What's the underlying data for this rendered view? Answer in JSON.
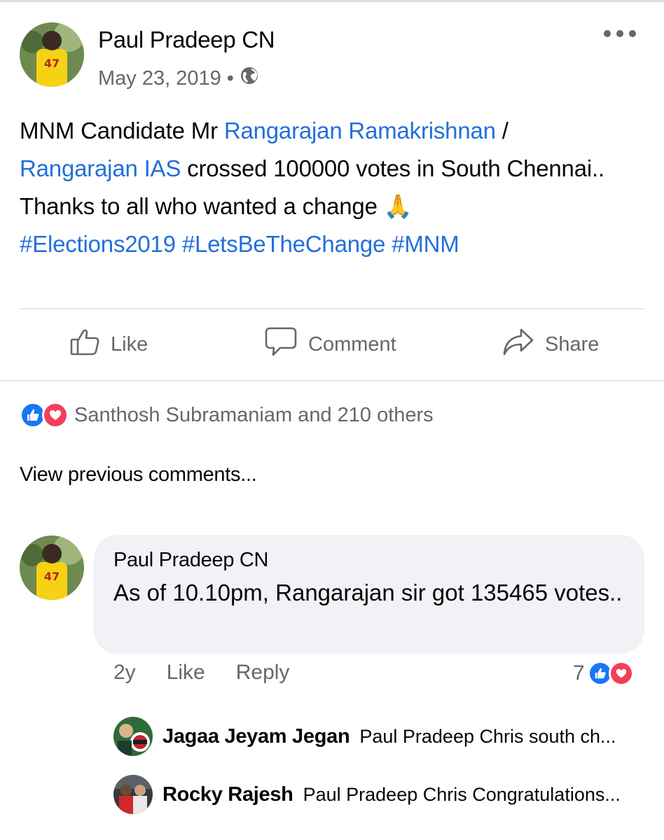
{
  "post": {
    "author": "Paul Pradeep CN",
    "date": "May 23, 2019 •",
    "privacy_icon": "globe-icon",
    "text": {
      "part1": "MNM Candidate Mr ",
      "link1": "Rangarajan Ramakrishnan",
      "part2": " / ",
      "link2": "Rangarajan IAS",
      "part3": " crossed 100000 votes in South Chennai..",
      "line2": "Thanks to all who wanted a change",
      "emoji": "🙏",
      "hashtags": [
        "#Elections2019",
        "#LetsBeTheChange",
        "#MNM"
      ]
    }
  },
  "actions": {
    "like": "Like",
    "comment": "Comment",
    "share": "Share"
  },
  "reactions": {
    "summary": "Santhosh Subramaniam and 210 others"
  },
  "view_previous": "View previous comments...",
  "comment": {
    "author": "Paul Pradeep CN",
    "text": "As of 10.10pm, Rangarajan sir got 135465 votes..",
    "time": "2y",
    "like": "Like",
    "reply": "Reply",
    "reaction_count": "7"
  },
  "replies": [
    {
      "name": "Jagaa Jeyam Jegan",
      "text": "Paul Pradeep Chris south ch..."
    },
    {
      "name": "Rocky Rajesh",
      "text": "Paul Pradeep Chris Congratulations..."
    }
  ],
  "colors": {
    "link": "#216fdb",
    "muted": "#65676b",
    "like_blue": "#1877f2",
    "love_red": "#f33e58",
    "bubble": "#f0f2f5"
  }
}
